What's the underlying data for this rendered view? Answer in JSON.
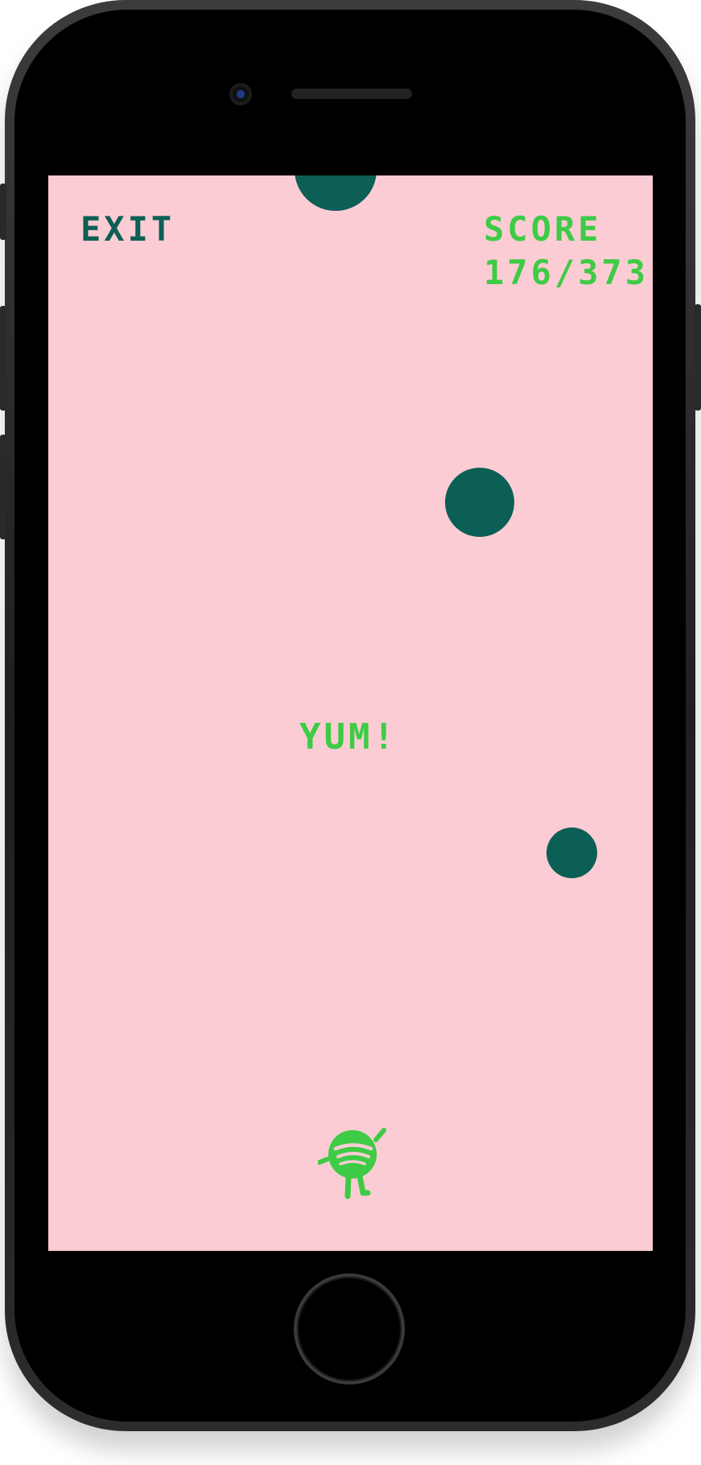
{
  "game": {
    "exit_label": "EXIT",
    "score_label": "SCORE",
    "score_value": "176/373",
    "feedback_text": "YUM!"
  },
  "colors": {
    "background": "#fbccd4",
    "ball": "#0b5f55",
    "exit_text": "#0d5f55",
    "accent_green": "#3ecb45"
  },
  "icons": {
    "player": "spotify-creature-icon"
  }
}
